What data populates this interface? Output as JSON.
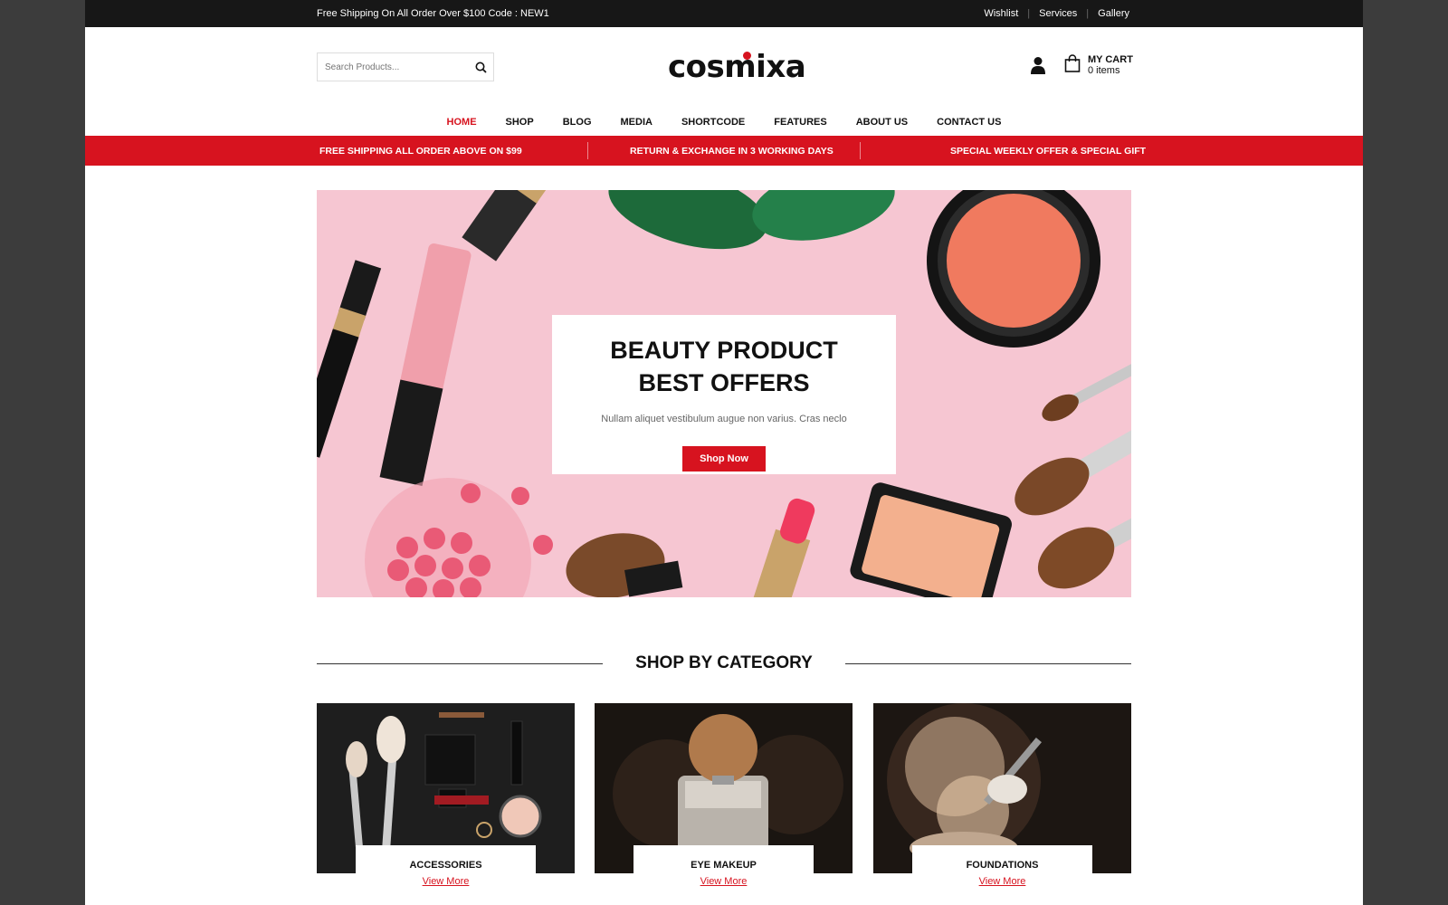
{
  "topbar": {
    "promo": "Free Shipping On All Order Over $100 Code : NEW1",
    "links": [
      "Wishlist",
      "Services",
      "Gallery"
    ]
  },
  "header": {
    "search_placeholder": "Search Products...",
    "logo": "cosmixa",
    "cart_title": "MY CART",
    "cart_count": "0 items"
  },
  "nav": [
    "HOME",
    "SHOP",
    "BLOG",
    "MEDIA",
    "SHORTCODE",
    "FEATURES",
    "ABOUT US",
    "CONTACT US"
  ],
  "redbar": [
    "FREE SHIPPING ALL ORDER ABOVE ON $99",
    "RETURN & EXCHANGE IN 3 WORKING DAYS",
    "SPECIAL WEEKLY OFFER & SPECIAL GIFT"
  ],
  "hero": {
    "title_line1": "BEAUTY PRODUCT",
    "title_line2": "BEST OFFERS",
    "subtitle": "Nullam aliquet vestibulum augue non varius. Cras neclo",
    "button": "Shop Now"
  },
  "section_title": "SHOP BY CATEGORY",
  "categories": [
    {
      "name": "ACCESSORIES",
      "link": "View More"
    },
    {
      "name": "EYE MAKEUP",
      "link": "View More"
    },
    {
      "name": "FOUNDATIONS",
      "link": "View More"
    }
  ],
  "colors": {
    "accent": "#d7131f",
    "topbar": "#171717",
    "hero_bg": "#f6c6d2"
  }
}
